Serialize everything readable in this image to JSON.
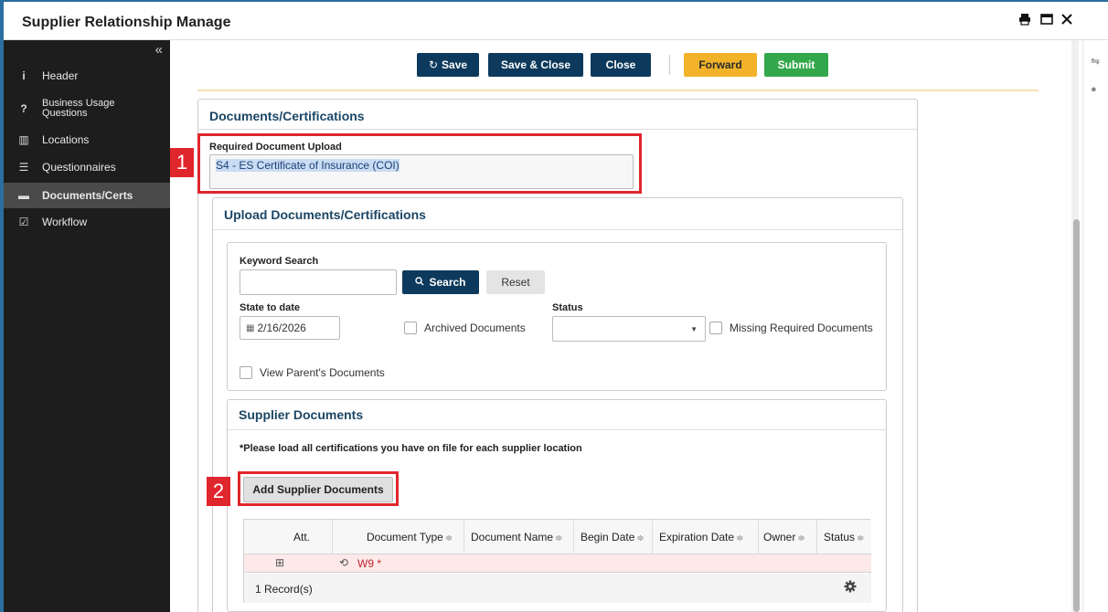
{
  "window": {
    "title": "Supplier Relationship Manage",
    "controls": [
      "print-icon",
      "maximize-icon",
      "close-icon"
    ]
  },
  "sidebar": {
    "collapse_glyph": "«",
    "items": [
      {
        "label": "Header",
        "icon": "info-icon",
        "glyph": "i"
      },
      {
        "label": "Business Usage Questions",
        "icon": "question-icon",
        "glyph": "?"
      },
      {
        "label": "Locations",
        "icon": "map-icon",
        "glyph": "▥"
      },
      {
        "label": "Questionnaires",
        "icon": "list-icon",
        "glyph": "☰"
      },
      {
        "label": "Documents/Certs",
        "icon": "document-icon",
        "glyph": "▬",
        "active": true
      },
      {
        "label": "Workflow",
        "icon": "checkbox-icon",
        "glyph": "☑"
      }
    ]
  },
  "toolbar": {
    "save": "Save",
    "save_glyph": "↻",
    "save_close": "Save & Close",
    "close": "Close",
    "forward": "Forward",
    "submit": "Submit"
  },
  "documents_panel": {
    "heading": "Documents/Certifications",
    "required_label": "Required Document Upload",
    "required_value": "S4 - ES Certificate of Insurance (COI)"
  },
  "upload_panel": {
    "heading": "Upload Documents/Certifications",
    "keyword_label": "Keyword Search",
    "keyword_value": "",
    "search_button": "Search",
    "reset_button": "Reset",
    "state_label": "State to date",
    "state_value": "2/16/2026",
    "archived_label": "Archived Documents",
    "status_label": "Status",
    "status_value": "",
    "missing_label": "Missing Required Documents",
    "parent_label": "View Parent's Documents"
  },
  "supplier_panel": {
    "heading": "Supplier Documents",
    "note": "*Please load all certifications you have on file for each supplier location",
    "add_button": "Add Supplier Documents",
    "table": {
      "columns": [
        "Att.",
        "Document Type",
        "Document Name",
        "Begin Date",
        "Expiration Date",
        "Owner",
        "Status"
      ],
      "rows": [
        {
          "att": "⊞",
          "history_glyph": "⟲",
          "document_type": "W9 *",
          "document_name": "",
          "begin_date": "",
          "expiration_date": "",
          "owner": "",
          "status": ""
        }
      ],
      "record_count": "1 Record(s)"
    }
  },
  "annotations": {
    "badge_1": "1",
    "badge_2": "2"
  },
  "colors": {
    "navy": "#0d3a5c",
    "forward": "#f2b32a",
    "submit": "#33a84a",
    "highlight_red": "#e0262d",
    "missing_row": "#fde9e9"
  }
}
